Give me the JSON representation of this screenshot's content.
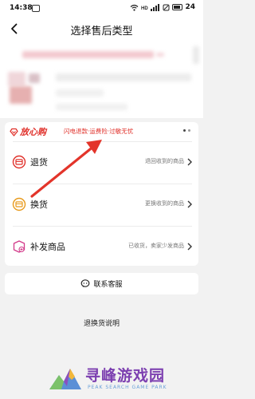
{
  "status_bar": {
    "time": "14:38",
    "battery": "24",
    "icons": [
      "app-icon",
      "wifi-icon",
      "hd-icon",
      "signal-icon",
      "mute-icon",
      "battery-icon"
    ]
  },
  "nav": {
    "title": "选择售后类型",
    "back_icon": "back-arrow-icon"
  },
  "service": {
    "brand": "放心购",
    "tagline": "闪电退款·运费险·过敏无忧",
    "brand_color": "#e0302a",
    "options": [
      {
        "label": "退货",
        "desc": "退回收到的商品",
        "icon": "return-goods-icon"
      },
      {
        "label": "换货",
        "desc": "更换收到的商品",
        "icon": "exchange-goods-icon"
      },
      {
        "label": "补发商品",
        "desc": "已收货，卖家少发商品",
        "icon": "reissue-goods-icon"
      }
    ]
  },
  "contact": {
    "label": "联系客服",
    "icon": "customer-service-icon"
  },
  "footer_link": "退换货说明",
  "watermark": {
    "title": "寻峰游戏园",
    "subtitle": "PEAK SEARCH GAME PARK"
  },
  "annotation": {
    "color": "#e3342a",
    "icon": "red-arrow-annotation"
  }
}
